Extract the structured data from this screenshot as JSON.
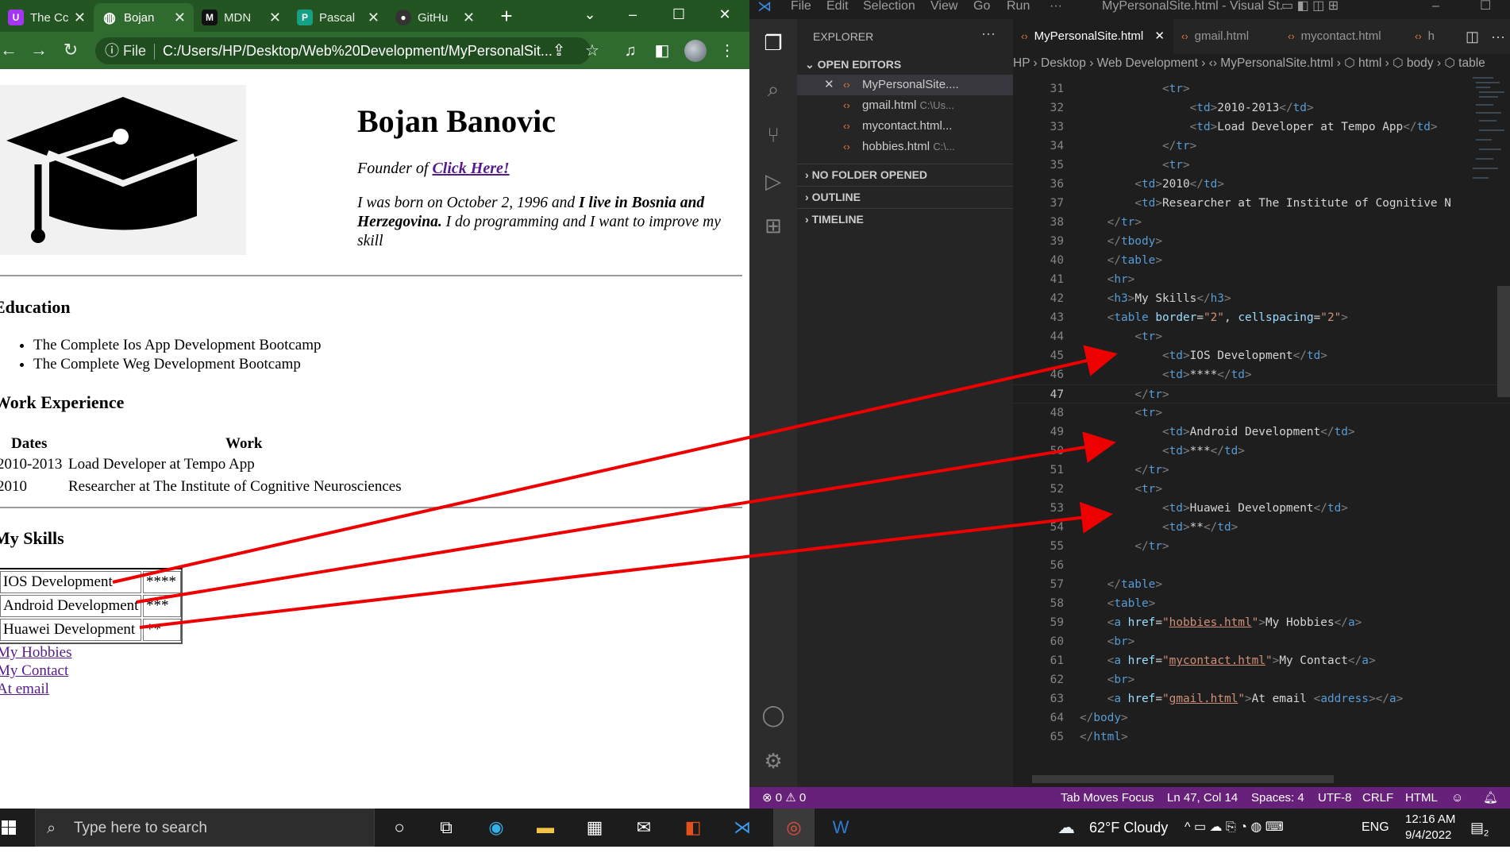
{
  "browser": {
    "tabs": [
      {
        "label": "The Cc",
        "icon": "udemy-icon",
        "color": "#a435f0",
        "glyph": "U"
      },
      {
        "label": "Bojan",
        "icon": "globe-icon",
        "color": "#5aa0e6",
        "glyph": "◍"
      },
      {
        "label": "MDN",
        "icon": "mdn-icon",
        "color": "#111111",
        "glyph": "M"
      },
      {
        "label": "Pascal",
        "icon": "pascal-icon",
        "color": "#16a085",
        "glyph": "P"
      },
      {
        "label": "GitHu",
        "icon": "github-icon",
        "color": "#333333",
        "glyph": "●"
      }
    ],
    "file_label": "File",
    "url": "C:/Users/HP/Desktop/Web%20Development/MyPersonalSit..."
  },
  "page": {
    "name": "Bojan Banovic",
    "founder_prefix": "Founder of ",
    "founder_link": "Click Here!",
    "bio_part1": "I was born on October 2, 1996 and ",
    "bio_bold": "I live in Bosnia and Herzegovina.",
    "bio_part2": " I do programming and I want to improve my skill",
    "education_heading": "Education",
    "education": [
      "The Complete Ios App Development Bootcamp",
      "The Complete Weg Development Bootcamp"
    ],
    "work_heading": "Work Experience",
    "work_headers": [
      "Dates",
      "Work"
    ],
    "work_rows": [
      {
        "date": "2010-2013",
        "work": "Load Developer at Tempo App"
      },
      {
        "date": "2010",
        "work": "Researcher at The Institute of Cognitive Neurosciences"
      }
    ],
    "skills_heading": "My Skills",
    "skills": [
      {
        "name": "IOS Development",
        "stars": "****"
      },
      {
        "name": "Android Development",
        "stars": "***"
      },
      {
        "name": "Huawei Development",
        "stars": "**"
      }
    ],
    "links": [
      "My Hobbies",
      "My Contact",
      "At email"
    ]
  },
  "vscode": {
    "menu": [
      "File",
      "Edit",
      "Selection",
      "View",
      "Go",
      "Run",
      "···"
    ],
    "title": "MyPersonalSite.html - Visual St...",
    "explorer_label": "EXPLORER",
    "explorer_more": "···",
    "open_editors_label": "OPEN EDITORS",
    "open_editors": [
      {
        "name": "MyPersonalSite....",
        "path": ""
      },
      {
        "name": "gmail.html",
        "path": "C:\\Us..."
      },
      {
        "name": "mycontact.html...",
        "path": ""
      },
      {
        "name": "hobbies.html",
        "path": "C:\\..."
      }
    ],
    "no_folder_label": "NO FOLDER OPENED",
    "outline_label": "OUTLINE",
    "timeline_label": "TIMELINE",
    "tabs": [
      "MyPersonalSite.html",
      "gmail.html",
      "mycontact.html",
      "h"
    ],
    "breadcrumbs": "HP › Desktop › Web Development › ‹› MyPersonalSite.html › ⬡ html › ⬡ body › ⬡ table",
    "current_line": 47,
    "lines": [
      {
        "n": 31,
        "ind": 12,
        "h": "<span class='p'>&lt;</span><span class='t'>tr</span><span class='p'>&gt;</span>"
      },
      {
        "n": 32,
        "ind": 16,
        "h": "<span class='p'>&lt;</span><span class='t'>td</span><span class='p'>&gt;</span>2010-2013<span class='p'>&lt;/</span><span class='t'>td</span><span class='p'>&gt;</span>"
      },
      {
        "n": 33,
        "ind": 16,
        "h": "<span class='p'>&lt;</span><span class='t'>td</span><span class='p'>&gt;</span>Load Developer at Tempo App<span class='p'>&lt;/</span><span class='t'>td</span><span class='p'>&gt;</span>"
      },
      {
        "n": 34,
        "ind": 12,
        "h": "<span class='p'>&lt;/</span><span class='t'>tr</span><span class='p'>&gt;</span>"
      },
      {
        "n": 35,
        "ind": 12,
        "h": "<span class='p'>&lt;</span><span class='t'>tr</span><span class='p'>&gt;</span>"
      },
      {
        "n": 36,
        "ind": 8,
        "h": "<span class='p'>&lt;</span><span class='t'>td</span><span class='p'>&gt;</span>2010<span class='p'>&lt;/</span><span class='t'>td</span><span class='p'>&gt;</span>"
      },
      {
        "n": 37,
        "ind": 8,
        "h": "<span class='p'>&lt;</span><span class='t'>td</span><span class='p'>&gt;</span>Researcher at The Institute of Cognitive N"
      },
      {
        "n": 38,
        "ind": 4,
        "h": "<span class='p'>&lt;/</span><span class='t'>tr</span><span class='p'>&gt;</span>"
      },
      {
        "n": 39,
        "ind": 4,
        "h": "<span class='p'>&lt;/</span><span class='t'>tbody</span><span class='p'>&gt;</span>"
      },
      {
        "n": 40,
        "ind": 4,
        "h": "<span class='p'>&lt;/</span><span class='t'>table</span><span class='p'>&gt;</span>"
      },
      {
        "n": 41,
        "ind": 4,
        "h": "<span class='p'>&lt;</span><span class='t'>hr</span><span class='p'>&gt;</span>"
      },
      {
        "n": 42,
        "ind": 4,
        "h": "<span class='p'>&lt;</span><span class='t'>h3</span><span class='p'>&gt;</span>My Skills<span class='p'>&lt;/</span><span class='t'>h3</span><span class='p'>&gt;</span>"
      },
      {
        "n": 43,
        "ind": 4,
        "h": "<span class='p'>&lt;</span><span class='t'>table</span> <span class='a'>border</span>=<span class='s'>\"2\"</span>, <span class='a'>cellspacing</span>=<span class='s'>\"2\"</span><span class='p'>&gt;</span>"
      },
      {
        "n": 44,
        "ind": 8,
        "h": "<span class='p'>&lt;</span><span class='t'>tr</span><span class='p'>&gt;</span>"
      },
      {
        "n": 45,
        "ind": 12,
        "h": "<span class='p'>&lt;</span><span class='t'>td</span><span class='p'>&gt;</span>IOS Development<span class='p'>&lt;/</span><span class='t'>td</span><span class='p'>&gt;</span>"
      },
      {
        "n": 46,
        "ind": 12,
        "h": "<span class='p'>&lt;</span><span class='t'>td</span><span class='p'>&gt;</span>****<span class='p'>&lt;/</span><span class='t'>td</span><span class='p'>&gt;</span>"
      },
      {
        "n": 47,
        "ind": 8,
        "h": "<span class='p'>&lt;/</span><span class='t'>tr</span><span class='p'>&gt;</span>"
      },
      {
        "n": 48,
        "ind": 8,
        "h": "<span class='p'>&lt;</span><span class='t'>tr</span><span class='p'>&gt;</span>"
      },
      {
        "n": 49,
        "ind": 12,
        "h": "<span class='p'>&lt;</span><span class='t'>td</span><span class='p'>&gt;</span>Android Development<span class='p'>&lt;/</span><span class='t'>td</span><span class='p'>&gt;</span>"
      },
      {
        "n": 50,
        "ind": 12,
        "h": "<span class='p'>&lt;</span><span class='t'>td</span><span class='p'>&gt;</span>***<span class='p'>&lt;/</span><span class='t'>td</span><span class='p'>&gt;</span>"
      },
      {
        "n": 51,
        "ind": 8,
        "h": "<span class='p'>&lt;/</span><span class='t'>tr</span><span class='p'>&gt;</span>"
      },
      {
        "n": 52,
        "ind": 8,
        "h": "<span class='p'>&lt;</span><span class='t'>tr</span><span class='p'>&gt;</span>"
      },
      {
        "n": 53,
        "ind": 12,
        "h": "<span class='p'>&lt;</span><span class='t'>td</span><span class='p'>&gt;</span>Huawei Development<span class='p'>&lt;/</span><span class='t'>td</span><span class='p'>&gt;</span>"
      },
      {
        "n": 54,
        "ind": 12,
        "h": "<span class='p'>&lt;</span><span class='t'>td</span><span class='p'>&gt;</span>**<span class='p'>&lt;/</span><span class='t'>td</span><span class='p'>&gt;</span>"
      },
      {
        "n": 55,
        "ind": 8,
        "h": "<span class='p'>&lt;/</span><span class='t'>tr</span><span class='p'>&gt;</span>"
      },
      {
        "n": 56,
        "ind": 0,
        "h": ""
      },
      {
        "n": 57,
        "ind": 4,
        "h": "<span class='p'>&lt;/</span><span class='t'>table</span><span class='p'>&gt;</span>"
      },
      {
        "n": 58,
        "ind": 4,
        "h": "<span class='p'>&lt;</span><span class='t'>table</span><span class='p'>&gt;</span>"
      },
      {
        "n": 59,
        "ind": 4,
        "h": "<span class='p'>&lt;</span><span class='t'>a</span> <span class='a'>href</span>=<span class='s'>\"</span><span class='au'>hobbies.html</span><span class='s'>\"</span><span class='p'>&gt;</span>My Hobbies<span class='p'>&lt;/</span><span class='t'>a</span><span class='p'>&gt;</span>"
      },
      {
        "n": 60,
        "ind": 4,
        "h": "<span class='p'>&lt;</span><span class='t'>br</span><span class='p'>&gt;</span>"
      },
      {
        "n": 61,
        "ind": 4,
        "h": "<span class='p'>&lt;</span><span class='t'>a</span> <span class='a'>href</span>=<span class='s'>\"</span><span class='au'>mycontact.html</span><span class='s'>\"</span><span class='p'>&gt;</span>My Contact<span class='p'>&lt;/</span><span class='t'>a</span><span class='p'>&gt;</span>"
      },
      {
        "n": 62,
        "ind": 4,
        "h": "<span class='p'>&lt;</span><span class='t'>br</span><span class='p'>&gt;</span>"
      },
      {
        "n": 63,
        "ind": 4,
        "h": "<span class='p'>&lt;</span><span class='t'>a</span> <span class='a'>href</span>=<span class='s'>\"</span><span class='au'>gmail.html</span><span class='s'>\"</span><span class='p'>&gt;</span>At email <span class='p'>&lt;</span><span class='t'>address</span><span class='p'>&gt;&lt;/</span><span class='t'>a</span><span class='p'>&gt;</span>"
      },
      {
        "n": 64,
        "ind": 0,
        "h": "<span class='p'>&lt;/</span><span class='t'>body</span><span class='p'>&gt;</span>"
      },
      {
        "n": 65,
        "ind": 0,
        "h": "<span class='p'>&lt;/</span><span class='t'>html</span><span class='p'>&gt;</span>"
      }
    ],
    "status": {
      "problems": "⊗ 0 ⚠ 0",
      "tab_moves_focus": "Tab Moves Focus",
      "position": "Ln 47, Col 14",
      "spaces": "Spaces: 4",
      "encoding": "UTF-8",
      "eol": "CRLF",
      "language": "HTML"
    }
  },
  "taskbar": {
    "search_placeholder": "Type here to search",
    "weather": "62°F  Cloudy",
    "lang": "ENG",
    "time": "12:16 AM",
    "date": "9/4/2022",
    "notifications": "2"
  },
  "colors": {
    "chrome_green": "#225522",
    "vscode_status": "#68217a",
    "annotation_red": "#ee0000"
  }
}
